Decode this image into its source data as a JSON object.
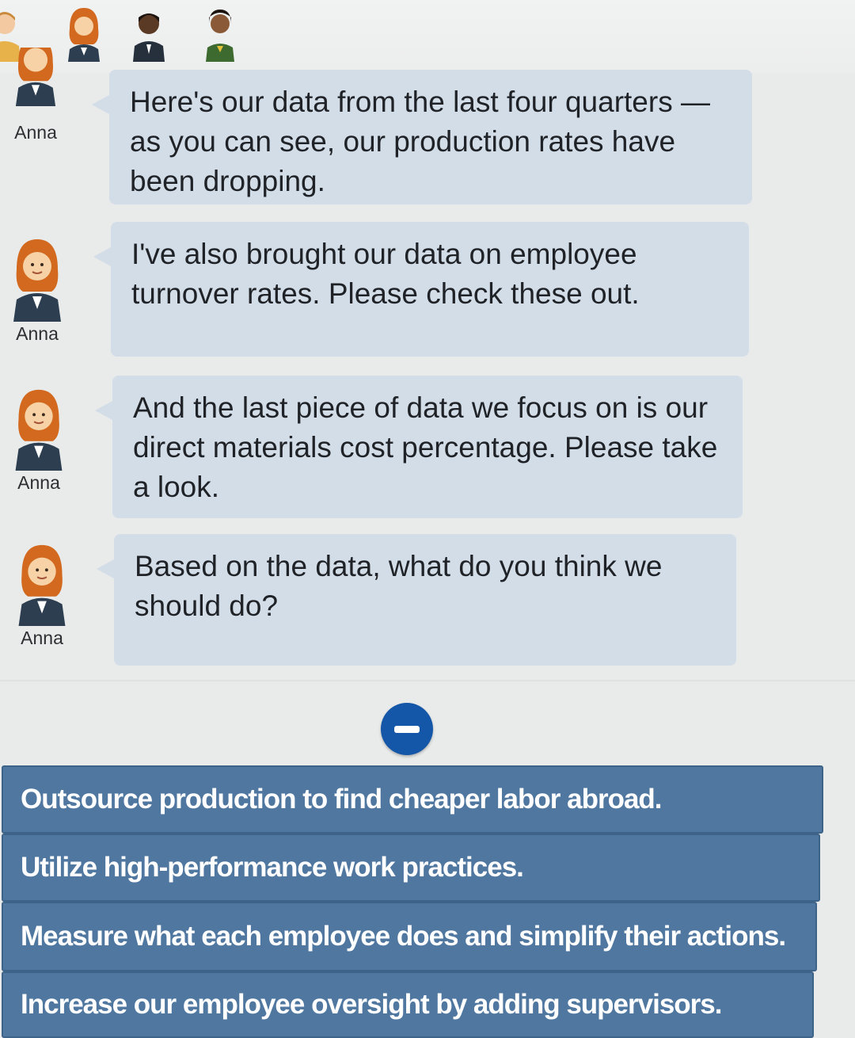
{
  "participants": [
    {
      "icon": "person-avatar-icon",
      "name": "",
      "tone": "light"
    },
    {
      "icon": "anna-avatar-icon",
      "name": "",
      "tone": "light"
    },
    {
      "icon": "person-avatar-icon",
      "name": "",
      "tone": "dark"
    },
    {
      "icon": "person-avatar-icon",
      "name": "",
      "tone": "medium"
    }
  ],
  "messages": [
    {
      "speaker": "Anna",
      "text": "Here's our data from the last four quarters —as you can see, our production rates have been dropping."
    },
    {
      "speaker": "Anna",
      "text": "I've also brought our data on employee turnover rates. Please check these out."
    },
    {
      "speaker": "Anna",
      "text": "And the last piece of data we focus on is our direct materials cost percentage. Please take a look."
    },
    {
      "speaker": "Anna",
      "text": "Based on the data, what do you think we should do?"
    }
  ],
  "collapse_button": {
    "icon": "minus-circle-icon"
  },
  "choices": [
    "Outsource production to find cheaper labor abroad.",
    "Utilize high-performance work practices.",
    "Measure what each employee does and simplify their actions.",
    "Increase our employee oversight by adding supervisors."
  ],
  "colors": {
    "bubble": "#d3dde8",
    "choice_button": "#4f77a0",
    "collapse_button": "#1457a8",
    "hair": "#d2691e",
    "suit": "#2c3e50"
  }
}
